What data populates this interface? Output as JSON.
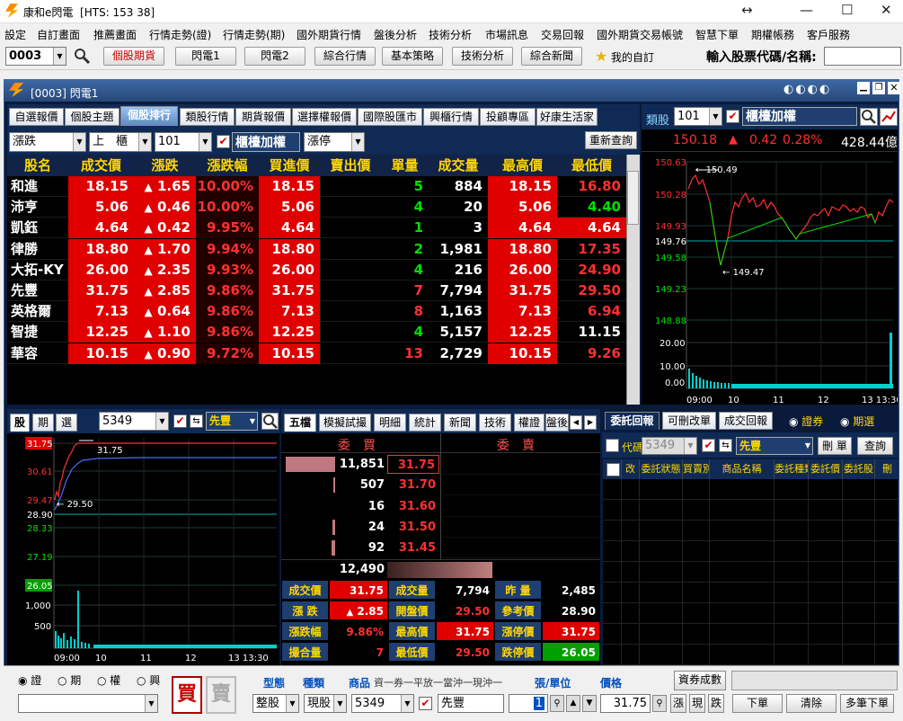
{
  "window": {
    "title": "康和e閃電",
    "hts": "[HTS: 153 38]"
  },
  "menu": [
    "設定",
    "自訂畫面",
    "推薦畫面",
    "行情走勢(證)",
    "行情走勢(期)",
    "國外期貨行情",
    "盤後分析",
    "技術分析",
    "市場訊息",
    "交易回報",
    "國外期貨交易帳號",
    "智慧下單",
    "期權帳務",
    "客戶服務"
  ],
  "toolbar": {
    "code": "0003",
    "buttons": [
      "個股期貨",
      "閃電1",
      "閃電2",
      "綜合行情",
      "基本策略",
      "技術分析",
      "綜合新聞"
    ],
    "fav": "我的自訂",
    "input_label": "輸入股票代碼/名稱:"
  },
  "subwindow": {
    "title": "[0003] 閃電1"
  },
  "tabs": [
    "自選報價",
    "個股主題",
    "個股排行",
    "類股行情",
    "期貨報價",
    "選擇權報價",
    "國際股匯市",
    "興櫃行情",
    "投顧專區",
    "好康生活家"
  ],
  "filter": {
    "sort": "漲跌",
    "dir": "上　櫃",
    "code": "101",
    "market": "櫃檯加權",
    "cond": "漲停",
    "refresh": "重新查詢"
  },
  "table": {
    "headers": [
      "股名",
      "成交價",
      "漲跌",
      "漲跌幅",
      "買進價",
      "賣出價",
      "單量",
      "成交量",
      "最高價",
      "最低價"
    ],
    "rows": [
      {
        "name": "和進",
        "price": "18.15",
        "chg": "1.65",
        "pct": "10.00%",
        "bid": "18.15",
        "ask": "",
        "vol1": "5",
        "vol": "884",
        "high": "18.15",
        "low": "16.80",
        "lowc": "r"
      },
      {
        "name": "沛亨",
        "price": "5.06",
        "chg": "0.46",
        "pct": "10.00%",
        "bid": "5.06",
        "ask": "",
        "vol1": "4",
        "vol": "20",
        "high": "5.06",
        "low": "4.40",
        "lowc": "g"
      },
      {
        "name": "凱鈺",
        "price": "4.64",
        "chg": "0.42",
        "pct": "9.95%",
        "bid": "4.64",
        "ask": "",
        "vol1": "1",
        "vol": "3",
        "high": "4.64",
        "low": "4.64",
        "lowc": "w"
      },
      {
        "name": "律勝",
        "price": "18.80",
        "chg": "1.70",
        "pct": "9.94%",
        "bid": "18.80",
        "ask": "",
        "vol1": "2",
        "vol": "1,981",
        "high": "18.80",
        "low": "17.35",
        "lowc": "r"
      },
      {
        "name": "大拓-KY",
        "price": "26.00",
        "chg": "2.35",
        "pct": "9.93%",
        "bid": "26.00",
        "ask": "",
        "vol1": "4",
        "vol": "216",
        "high": "26.00",
        "low": "24.90",
        "lowc": "r"
      },
      {
        "name": "先豐",
        "price": "31.75",
        "chg": "2.85",
        "pct": "9.86%",
        "bid": "31.75",
        "ask": "",
        "vol1": "7",
        "vol": "7,794",
        "high": "31.75",
        "low": "29.50",
        "lowc": "r"
      },
      {
        "name": "英格爾",
        "price": "7.13",
        "chg": "0.64",
        "pct": "9.86%",
        "bid": "7.13",
        "ask": "",
        "vol1": "8",
        "vol": "1,163",
        "high": "7.13",
        "low": "6.94",
        "lowc": "r"
      },
      {
        "name": "智捷",
        "price": "12.25",
        "chg": "1.10",
        "pct": "9.86%",
        "bid": "12.25",
        "ask": "",
        "vol1": "4",
        "vol": "5,157",
        "high": "12.25",
        "low": "11.15",
        "lowc": "w"
      },
      {
        "name": "華容",
        "price": "10.15",
        "chg": "0.90",
        "pct": "9.72%",
        "bid": "10.15",
        "ask": "",
        "vol1": "13",
        "vol": "2,729",
        "high": "10.15",
        "low": "9.26",
        "lowc": "r"
      }
    ]
  },
  "index_panel": {
    "label": "類股",
    "code": "101",
    "name": "櫃檯加權",
    "price": "150.18",
    "chg": "0.42",
    "pct": "0.28%",
    "amount": "428.44億",
    "ylabels": [
      "150.63",
      "150.28",
      "149.93",
      "149.76",
      "149.58",
      "149.23",
      "148.88",
      "20.00",
      "10.00",
      "0.00"
    ],
    "xlabels": [
      "09:00",
      "10",
      "11",
      "12",
      "13 13:30"
    ],
    "hi": "150.49",
    "lo": "149.47"
  },
  "stock_panel": {
    "tabs": [
      "股",
      "期",
      "選"
    ],
    "code": "5349",
    "name": "先豐",
    "ylabels": [
      "31.75",
      "30.61",
      "29.47",
      "28.90",
      "28.33",
      "27.19",
      "26.05",
      "1,000",
      "500"
    ],
    "xlabels": [
      "09:00",
      "10",
      "11",
      "12",
      "13 13:30"
    ],
    "hi": "31.75",
    "lo": "29.50"
  },
  "book": {
    "tabs": [
      "五檔",
      "模擬試撮",
      "明細",
      "統計",
      "新聞",
      "技術",
      "權證",
      "盤後"
    ],
    "bid_label": "委　買",
    "ask_label": "委　賣",
    "bids": [
      {
        "q": "11,851",
        "p": "31.75"
      },
      {
        "q": "507",
        "p": "31.70"
      },
      {
        "q": "16",
        "p": "31.60"
      },
      {
        "q": "24",
        "p": "31.50"
      },
      {
        "q": "92",
        "p": "31.45"
      }
    ],
    "total": "12,490",
    "stats": [
      [
        "成交價",
        "31.75",
        "成交量",
        "7,794",
        "昨 量",
        "2,485"
      ],
      [
        "漲 跌",
        "2.85",
        "開盤價",
        "29.50",
        "參考價",
        "28.90"
      ],
      [
        "漲跌幅",
        "9.86%",
        "最高價",
        "31.75",
        "漲停價",
        "31.75"
      ],
      [
        "撮合量",
        "7",
        "最低價",
        "29.50",
        "跌停價",
        "26.05"
      ]
    ]
  },
  "orders": {
    "tabs": [
      "委託回報",
      "可刪改單",
      "成交回報"
    ],
    "radio1": "證券",
    "radio2": "期選",
    "code_label": "代碼",
    "code": "5349",
    "name": "先豐",
    "del": "刪 單",
    "query": "查詢",
    "cols": [
      "改",
      "委託狀態",
      "買賣別",
      "商品名稱",
      "委託種類",
      "委託價",
      "委託股",
      "刪"
    ]
  },
  "orderbar": {
    "radios": [
      "證",
      "期",
      "權",
      "興"
    ],
    "buy": "買",
    "sell": "賣",
    "type_label": "型態",
    "kind_label": "種類",
    "prod_label": "商品",
    "opts": "資一券一平放一當沖一現沖一",
    "unit_label": "張/單位",
    "price_label": "價格",
    "fill_btn": "資券成數",
    "type": "整股",
    "kind": "現股",
    "code": "5349",
    "name": "先豐",
    "qty": "1",
    "price": "31.75",
    "limit_btns": [
      "漲",
      "現",
      "跌"
    ],
    "submit": "下單",
    "clear": "清除",
    "multi": "多筆下單"
  }
}
